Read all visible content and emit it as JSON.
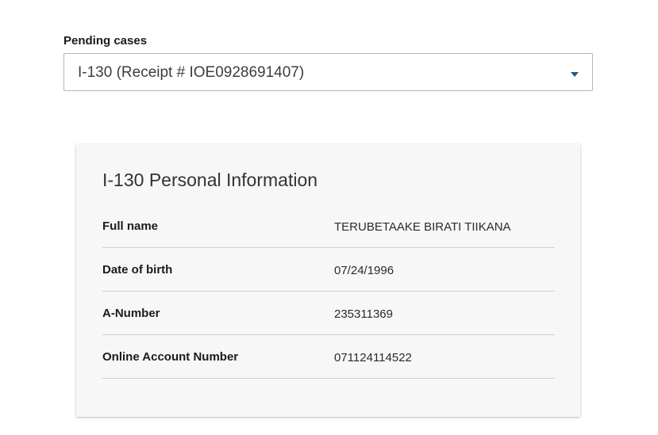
{
  "pending_cases": {
    "label": "Pending cases",
    "selected": "I-130 (Receipt # IOE0928691407)"
  },
  "card": {
    "title": "I-130 Personal Information",
    "rows": [
      {
        "label": "Full name",
        "value": "TERUBETAAKE BIRATI TIIKANA"
      },
      {
        "label": "Date of birth",
        "value": "07/24/1996"
      },
      {
        "label": "A-Number",
        "value": "235311369"
      },
      {
        "label": "Online Account Number",
        "value": "071124114522"
      }
    ]
  },
  "colors": {
    "caret": "#1a5b8a",
    "card_background": "#f7f7f7",
    "divider": "#cfcfcf"
  },
  "icons": {
    "dropdown": "chevron-down-icon"
  }
}
